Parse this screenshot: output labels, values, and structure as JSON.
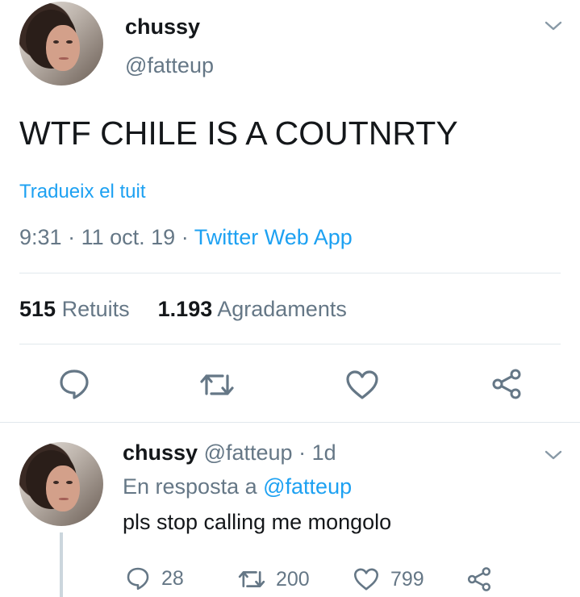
{
  "main_tweet": {
    "display_name": "chussy",
    "handle": "@fatteup",
    "text": "WTF CHILE IS A COUTNRTY",
    "translate_label": "Tradueix el tuit",
    "time": "9:31",
    "date": "11 oct. 19",
    "separator": "·",
    "source": "Twitter Web App",
    "retweets_count": "515",
    "retweets_label": "Retuits",
    "likes_count": "1.193",
    "likes_label": "Agradaments",
    "actions": [
      "reply-icon",
      "retweet-icon",
      "like-icon",
      "share-icon"
    ]
  },
  "reply_tweet": {
    "display_name": "chussy",
    "handle": "@fatteup",
    "age": "· 1d",
    "reply_prefix": "En resposta a",
    "reply_to": "@fatteup",
    "text": "pls stop calling me mongolo",
    "reply_count": "28",
    "retweet_count": "200",
    "like_count": "799"
  },
  "colors": {
    "accent": "#1da1f2",
    "text": "#14171a",
    "muted": "#657786",
    "divider": "#e1e8ed",
    "icon": "#657786"
  }
}
